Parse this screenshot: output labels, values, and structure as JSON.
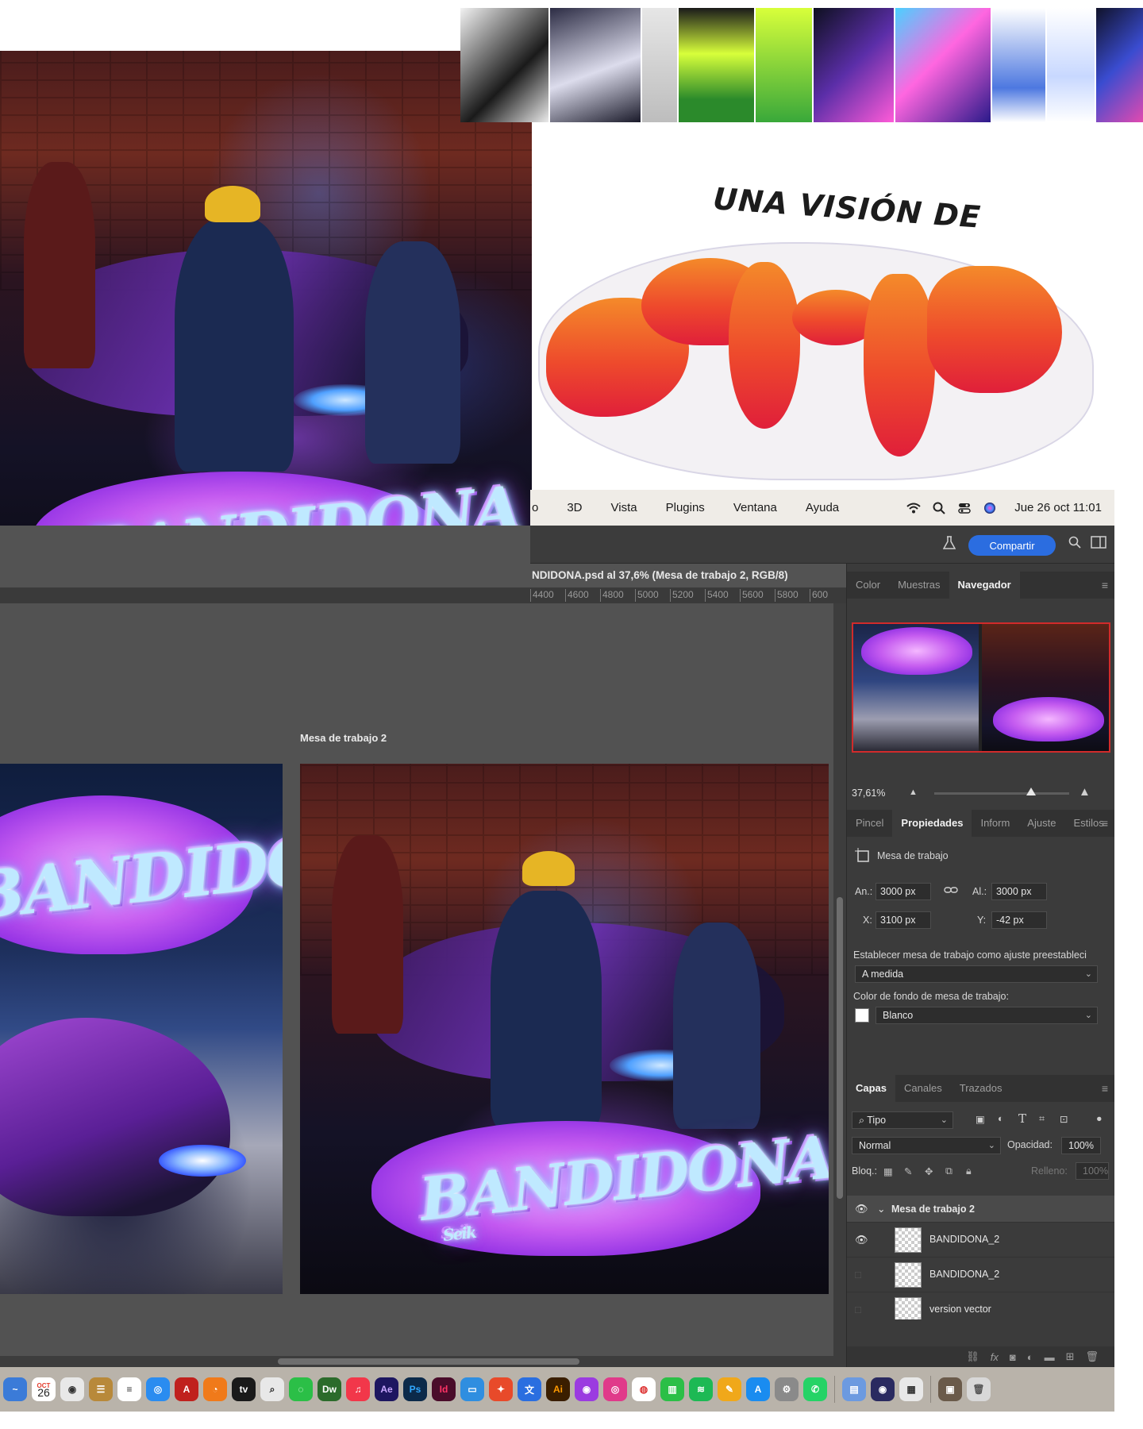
{
  "menubar": {
    "items": [
      "o",
      "3D",
      "Vista",
      "Plugins",
      "Ventana",
      "Ayuda"
    ],
    "clock": "Jue 26 oct 11:01",
    "icons": [
      "wifi-icon",
      "search-icon",
      "control-center-icon",
      "siri-icon"
    ]
  },
  "toolbar": {
    "share_label": "Compartir"
  },
  "document": {
    "tab_title": "NDIDONA.psd al 37,6% (Mesa de trabajo 2, RGB/8)"
  },
  "ruler": {
    "ticks": [
      "4400",
      "4600",
      "4800",
      "5000",
      "5200",
      "5400",
      "5600",
      "5800",
      "600"
    ]
  },
  "canvas": {
    "artboard_label": "Mesa de trabajo 2",
    "graffiti_text": "BANDIDONA",
    "tag_text": "Seik"
  },
  "collage": {
    "sticker_title": "UNA VISIÓN DE"
  },
  "navigator": {
    "tabs": [
      "Color",
      "Muestras",
      "Navegador"
    ],
    "active_tab": "Navegador",
    "zoom": "37,61%",
    "zoom_level": 0.72
  },
  "properties": {
    "tabs": [
      "Pincel",
      "Propiedades",
      "Inform",
      "Ajuste",
      "Estilos"
    ],
    "active_tab": "Propiedades",
    "section_title": "Mesa de trabajo",
    "width_label": "An.:",
    "width_value": "3000 px",
    "height_label": "Al.:",
    "height_value": "3000 px",
    "x_label": "X:",
    "x_value": "3100 px",
    "y_label": "Y:",
    "y_value": "-42 px",
    "preset_label": "Establecer mesa de trabajo como ajuste preestableci",
    "preset_value": "A medida",
    "bg_color_label": "Color de fondo de mesa de trabajo:",
    "bg_color_value": "Blanco"
  },
  "layers": {
    "tabs": [
      "Capas",
      "Canales",
      "Trazados"
    ],
    "active_tab": "Capas",
    "filter_label": "Tipo",
    "blend_mode": "Normal",
    "opacity_label": "Opacidad:",
    "opacity_value": "100%",
    "lock_label": "Bloq.:",
    "fill_label": "Relleno:",
    "fill_value": "100%",
    "group_name": "Mesa de trabajo 2",
    "items": [
      {
        "name": "BANDIDONA_2",
        "visible": true
      },
      {
        "name": "BANDIDONA_2",
        "visible": false
      },
      {
        "name": "version vector",
        "visible": false
      }
    ]
  },
  "dock": {
    "calendar_day": "26",
    "calendar_month": "OCT",
    "apps": [
      {
        "label": "Dw",
        "color": "#2b6b2b"
      },
      {
        "label": "Ae",
        "color": "#1d1660"
      },
      {
        "label": "Ps",
        "color": "#0c2a4a"
      },
      {
        "label": "Id",
        "color": "#4a0c2a"
      },
      {
        "label": "Ai",
        "color": "#3a1e00"
      }
    ]
  }
}
